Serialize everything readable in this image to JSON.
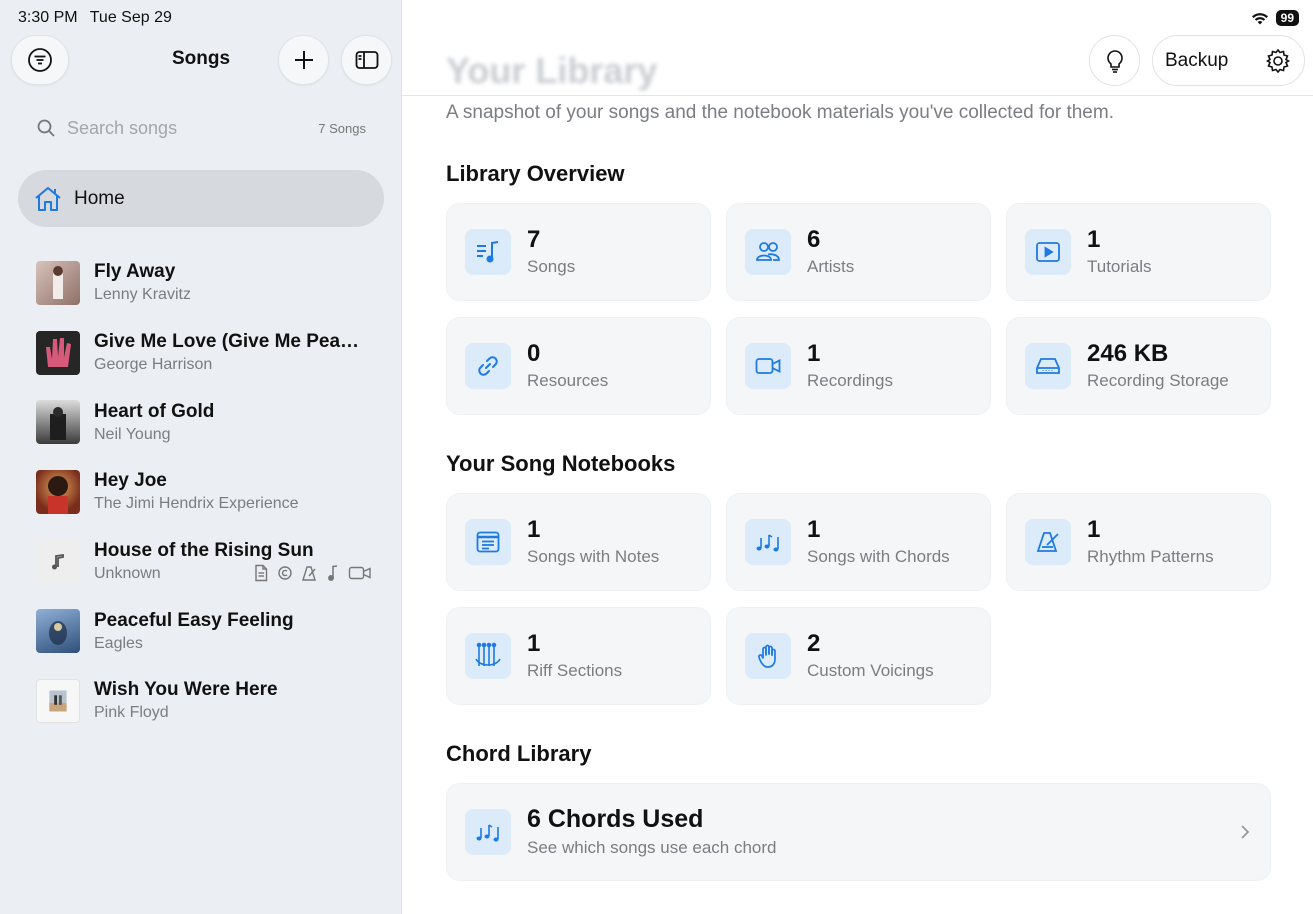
{
  "status": {
    "time": "3:30 PM",
    "date": "Tue Sep 29",
    "battery": "99"
  },
  "sidebar": {
    "title": "Songs",
    "search_placeholder": "Search songs",
    "song_count": "7 Songs",
    "home_label": "Home",
    "songs": [
      {
        "title": "Fly Away",
        "artist": "Lenny Kravitz",
        "thumb_color": "#c9a9a0"
      },
      {
        "title": "Give Me Love (Give Me Peac...",
        "artist": "George Harrison",
        "thumb_color": "#2b2b2b"
      },
      {
        "title": "Heart of Gold",
        "artist": "Neil Young",
        "thumb_color": "#555555"
      },
      {
        "title": "Hey Joe",
        "artist": "The Jimi Hendrix Experience",
        "thumb_color": "#8a3b2a"
      },
      {
        "title": "House of the Rising Sun",
        "artist": "Unknown",
        "thumb_color": "#eeeeee"
      },
      {
        "title": "Peaceful Easy Feeling",
        "artist": "Eagles",
        "thumb_color": "#5a7fa8"
      },
      {
        "title": "Wish You Were Here",
        "artist": "Pink Floyd",
        "thumb_color": "#f4f4f4"
      }
    ]
  },
  "main": {
    "header_title": "Your Library",
    "backup_label": "Backup",
    "subtitle": "A snapshot of your songs and the notebook materials you've collected for them.",
    "accent_color": "#1f7ae0",
    "overview": {
      "title": "Library Overview",
      "cards": [
        {
          "value": "7",
          "label": "Songs",
          "icon": "music-list-icon"
        },
        {
          "value": "6",
          "label": "Artists",
          "icon": "people-icon"
        },
        {
          "value": "1",
          "label": "Tutorials",
          "icon": "play-rectangle-icon"
        },
        {
          "value": "0",
          "label": "Resources",
          "icon": "link-icon"
        },
        {
          "value": "1",
          "label": "Recordings",
          "icon": "video-camera-icon"
        },
        {
          "value": "246 KB",
          "label": "Recording Storage",
          "icon": "drive-icon"
        }
      ]
    },
    "notebooks": {
      "title": "Your Song Notebooks",
      "cards": [
        {
          "value": "1",
          "label": "Songs with Notes",
          "icon": "notes-icon"
        },
        {
          "value": "1",
          "label": "Songs with Chords",
          "icon": "music-notes-icon"
        },
        {
          "value": "1",
          "label": "Rhythm Patterns",
          "icon": "metronome-icon"
        },
        {
          "value": "1",
          "label": "Riff Sections",
          "icon": "guitar-neck-icon"
        },
        {
          "value": "2",
          "label": "Custom Voicings",
          "icon": "hand-icon"
        }
      ]
    },
    "chords": {
      "title": "Chord Library",
      "value": "6 Chords Used",
      "label": "See which songs use each chord"
    }
  }
}
